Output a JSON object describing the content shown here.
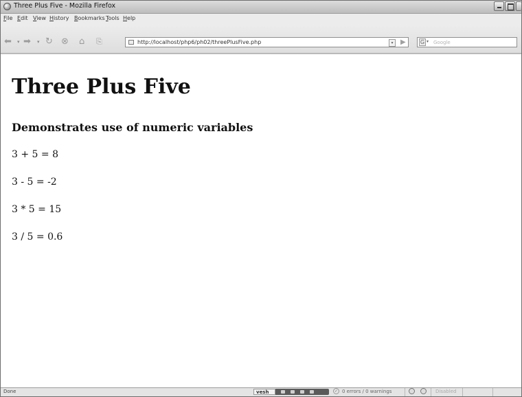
{
  "window": {
    "title": "Three Plus Five - Mozilla Firefox"
  },
  "menu": [
    "File",
    "Edit",
    "View",
    "History",
    "Bookmarks",
    "Tools",
    "Help"
  ],
  "toolbar": {
    "url": "http://localhost/php6/ph02/threePlusFive.php",
    "search_placeholder": "Google",
    "search_engine_glyph": "G"
  },
  "page": {
    "heading": "Three Plus Five",
    "subheading": "Demonstrates use of numeric variables",
    "lines": [
      "3 + 5 = 8",
      "3 - 5 = -2",
      "3 * 5 = 15",
      "3 / 5 = 0.6"
    ]
  },
  "status": {
    "text": "Done",
    "webdev_label": "vesh",
    "errors": "0 errors / 0 warnings",
    "disabled": "Disabled"
  },
  "colors": {
    "chrome": "#ececec",
    "content_bg": "#ffffff",
    "text": "#111111"
  }
}
